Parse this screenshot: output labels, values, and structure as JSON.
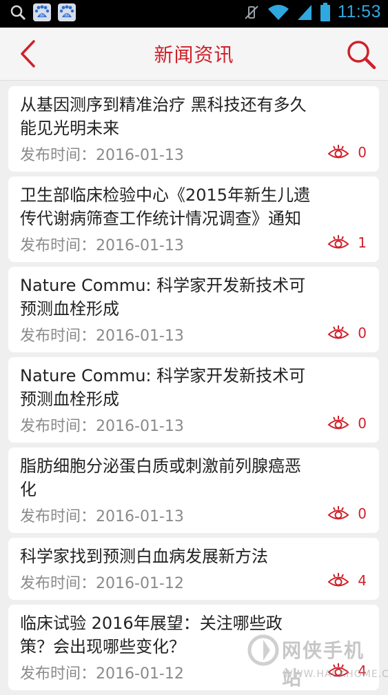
{
  "status_bar": {
    "time": "11:53",
    "baidu_label": "du"
  },
  "header": {
    "title": "新闻资讯"
  },
  "colors": {
    "accent": "#d0202a",
    "statusbar_icon": "#2fa8e0",
    "background": "#efefef"
  },
  "icons": {
    "back": "chevron-left-icon",
    "search": "search-icon",
    "views": "eye-icon"
  },
  "news": [
    {
      "title": "从基因测序到精准治疗 黑科技还有多久能见光明未来",
      "date_label": "发布时间：",
      "date": "2016-01-13",
      "views": "0"
    },
    {
      "title": "卫生部临床检验中心《2015年新生儿遗传代谢病筛查工作统计情况调查》通知",
      "date_label": "发布时间：",
      "date": "2016-01-13",
      "views": "1"
    },
    {
      "title": "Nature Commu: 科学家开发新技术可预测血栓形成",
      "date_label": "发布时间：",
      "date": "2016-01-13",
      "views": "0"
    },
    {
      "title": "Nature Commu: 科学家开发新技术可预测血栓形成",
      "date_label": "发布时间：",
      "date": "2016-01-13",
      "views": "0"
    },
    {
      "title": "脂肪细胞分泌蛋白质或刺激前列腺癌恶化",
      "date_label": "发布时间：",
      "date": "2016-01-13",
      "views": "0"
    },
    {
      "title": "科学家找到预测白血病发展新方法",
      "date_label": "发布时间：",
      "date": "2016-01-12",
      "views": "4"
    },
    {
      "title": "临床试验 2016年展望：关注哪些政策？会出现哪些变化？",
      "date_label": "发布时间：",
      "date": "2016-01-12",
      "views": "4"
    }
  ],
  "watermark": {
    "name": "网侠手机站",
    "url": "WWW.HACKHOME.COM"
  }
}
